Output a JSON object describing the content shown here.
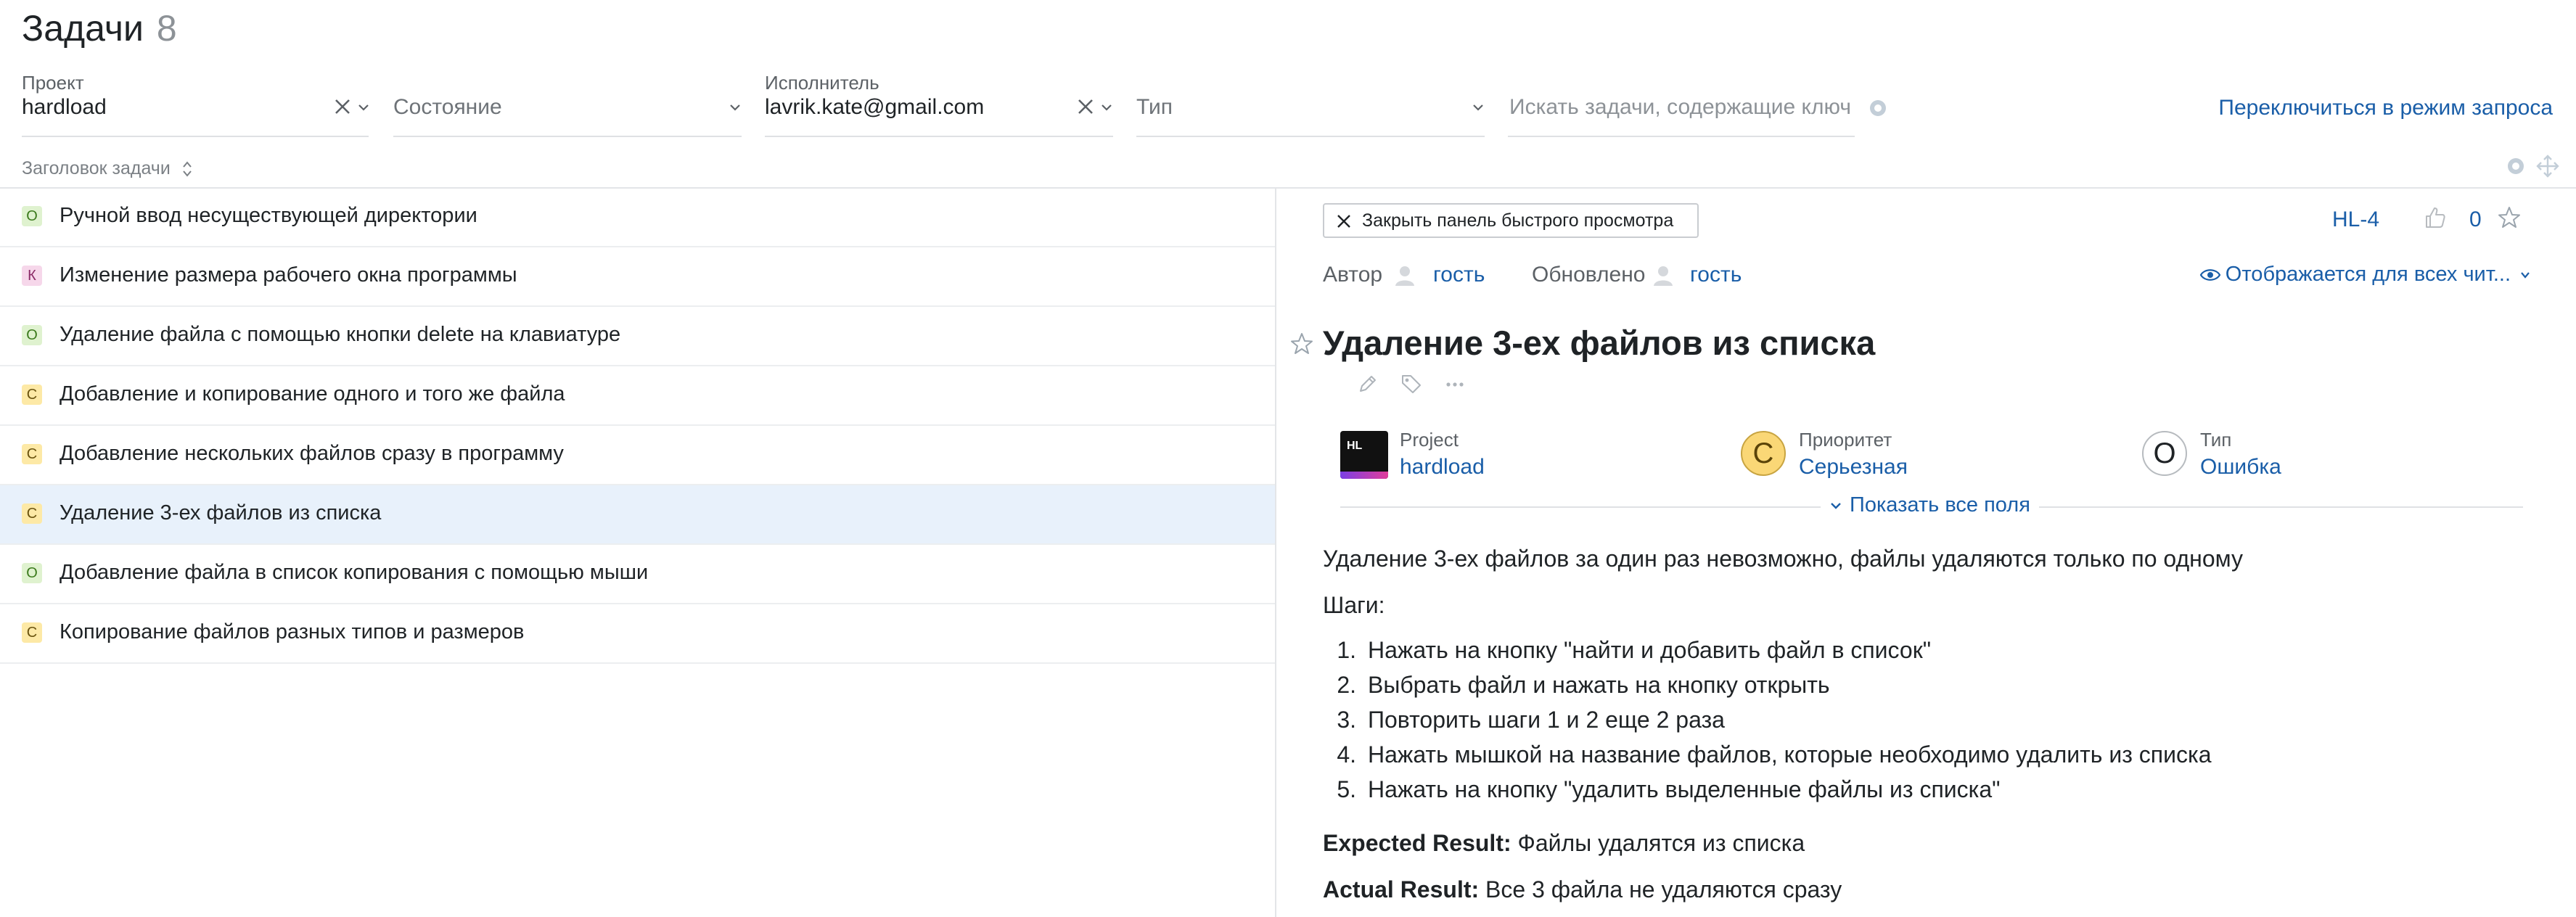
{
  "header": {
    "title": "Задачи",
    "count": "8"
  },
  "filters": {
    "project": {
      "label": "Проект",
      "value": "hardload"
    },
    "state": {
      "placeholder": "Состояние"
    },
    "assignee": {
      "label": "Исполнитель",
      "value": "lavrik.kate@gmail.com"
    },
    "type": {
      "placeholder": "Тип"
    },
    "search": {
      "placeholder": "Искать задачи, содержащие ключевые слова"
    },
    "switch_mode": "Переключиться в режим запроса"
  },
  "list_header": {
    "label": "Заголовок задачи"
  },
  "issues": [
    {
      "badge": "О",
      "title": "Ручной ввод несуществующей директории"
    },
    {
      "badge": "К",
      "title": "Изменение размера рабочего окна программы"
    },
    {
      "badge": "О",
      "title": "Удаление файла с помощью кнопки delete на клавиатуре"
    },
    {
      "badge": "С",
      "title": "Добавление и копирование одного и того же файла"
    },
    {
      "badge": "С",
      "title": "Добавление нескольких файлов сразу в программу"
    },
    {
      "badge": "С",
      "title": "Удаление 3-ех файлов из списка"
    },
    {
      "badge": "О",
      "title": "Добавление файла в список копирования с помощью мыши"
    },
    {
      "badge": "С",
      "title": "Копирование файлов разных типов и размеров"
    }
  ],
  "panel": {
    "close_label": "Закрыть панель быстрого просмотра",
    "issue_id": "HL-4",
    "votes": "0",
    "author_label": "Автор",
    "author": "гость",
    "updated_label": "Обновлено",
    "updater": "гость",
    "visibility": "Отображается для всех чит...",
    "title": "Удаление 3-ех файлов из списка",
    "fields": {
      "project": {
        "label": "Project",
        "value": "hardload",
        "logo_text": "HL"
      },
      "priority": {
        "label": "Приоритет",
        "value": "Серьезная",
        "letter": "С"
      },
      "type": {
        "label": "Тип",
        "value": "Ошибка",
        "letter": "О"
      }
    },
    "show_all": "Показать все поля",
    "description": {
      "summary": "Удаление 3-ех файлов за один раз невозможно, файлы удаляются только по одному",
      "steps_label": "Шаги:",
      "steps": [
        {
          "num": "1.",
          "text": "Нажать на кнопку \"найти и добавить файл в список\""
        },
        {
          "num": "2.",
          "text": "Выбрать файл и нажать на кнопку открыть"
        },
        {
          "num": "3.",
          "text": "Повторить шаги 1 и 2 еще 2 раза"
        },
        {
          "num": "4.",
          "text": "Нажать мышкой на название файлов, которые необходимо удалить из списка"
        },
        {
          "num": "5.",
          "text": "Нажать на кнопку \"удалить выделенные файлы из списка\""
        }
      ],
      "expected_label": "Expected Result:",
      "expected": "Файлы удалятся из списка",
      "actual_label": "Actual Result:",
      "actual": "Все 3 файла не удаляются сразу"
    }
  },
  "colors": {
    "link": "#1a5ea8",
    "selected_row": "#e8f1fb",
    "badge_o": "#dff2cf",
    "badge_k": "#f6d7ea",
    "badge_c": "#fde9a6"
  }
}
